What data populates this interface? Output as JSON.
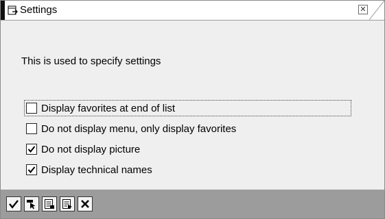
{
  "window": {
    "title": "Settings"
  },
  "description": "This is used to specify settings",
  "options": [
    {
      "label": "Display favorites at end of list",
      "checked": false,
      "focused": true
    },
    {
      "label": "Do not display menu, only display favorites",
      "checked": false,
      "focused": false
    },
    {
      "label": "Do not display picture",
      "checked": true,
      "focused": false
    },
    {
      "label": "Display technical names",
      "checked": true,
      "focused": false
    }
  ],
  "toolbar": {
    "buttons": [
      {
        "icon": "checkmark-icon"
      },
      {
        "icon": "select-pointer-icon"
      },
      {
        "icon": "document-list-icon"
      },
      {
        "icon": "document-list-alt-icon"
      },
      {
        "icon": "cancel-x-icon"
      }
    ]
  }
}
